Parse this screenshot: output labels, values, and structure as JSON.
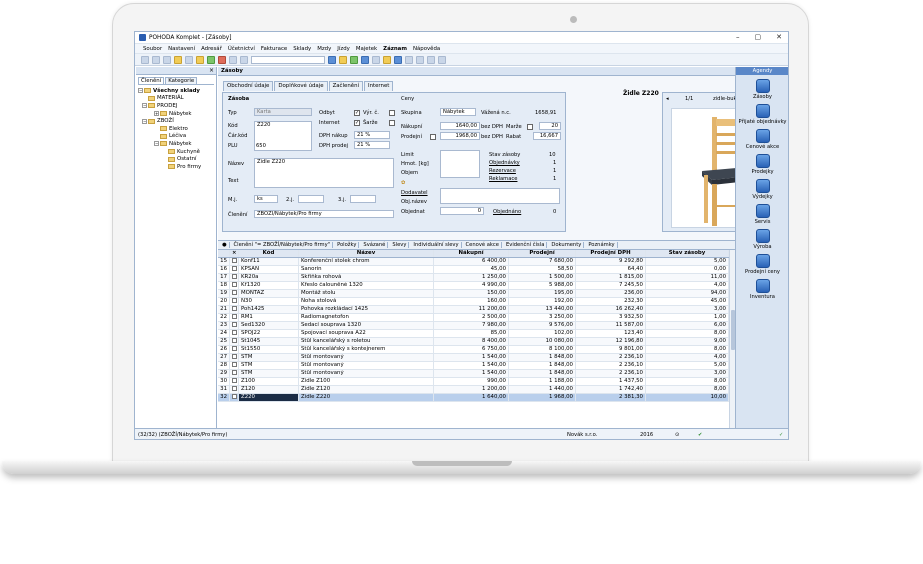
{
  "window": {
    "title": "POHODA Komplet - [Zásoby]",
    "controls": [
      "–",
      "▢",
      "✕"
    ]
  },
  "menu": [
    "Soubor",
    "Nastavení",
    "Adresář",
    "Účetnictví",
    "Fakturace",
    "Sklady",
    "Mzdy",
    "Jízdy",
    "Majetek",
    "Záznam",
    "Nápověda"
  ],
  "left_panel": {
    "tabs": [
      "Členění",
      "Kategorie"
    ],
    "tree": [
      {
        "label": "Všechny sklady",
        "level": 0,
        "expanded": true
      },
      {
        "label": "MATERIÁL",
        "level": 1
      },
      {
        "label": "PRODEJ",
        "level": 1,
        "expanded": true
      },
      {
        "label": "Nábytek",
        "level": 2
      },
      {
        "label": "ZBOŽÍ",
        "level": 1,
        "expanded": true
      },
      {
        "label": "Elektro",
        "level": 2
      },
      {
        "label": "Léčiva",
        "level": 2
      },
      {
        "label": "Nábytek",
        "level": 2,
        "expanded": true
      },
      {
        "label": "Kuchyně",
        "level": 3
      },
      {
        "label": "Ostatní",
        "level": 3
      },
      {
        "label": "Pro firmy",
        "level": 3
      }
    ]
  },
  "main": {
    "header": "Zásoby",
    "tabs": [
      "Obchodní údaje",
      "Doplňkové údaje",
      "Začlenění",
      "Internet"
    ],
    "product_title": "Židle Z220",
    "form": {
      "section": "Zásoba",
      "typ_label": "Typ",
      "typ_value": "Karta",
      "odbyt_label": "Odbyt",
      "vyr_label": "Výr. č.",
      "internet_label": "Internet",
      "sarze_label": "Šarže",
      "kod_label": "Kód",
      "kod_value": "Z220",
      "car_kod_label": "Čár.kód",
      "plu_label": "PLU",
      "plu_value": "650",
      "dph_nakup_label": "DPH nákup",
      "dph_nakup_value": "21 %",
      "dph_prodej_label": "DPH prodej",
      "dph_prodej_value": "21 %",
      "nazev_label": "Název",
      "nazev_value": "Židle Z220",
      "text_label": "Text",
      "mj_label": "M.j.",
      "mj_value": "ks",
      "zj_label": "2.j.",
      "tj_label": "3.j.",
      "cleneni_label": "Členění",
      "cleneni_value": "ZBOŽÍ/Nábytek/Pro firmy",
      "ceny_label": "Ceny",
      "skupina_label": "Skupina",
      "skupina_value": "Nábytek",
      "vazena_label": "Vážená n.c.",
      "vazena_value": "1658,91",
      "nakupni_label": "Nákupní",
      "nakupni_value": "1640,00",
      "bez_dph": "bez DPH",
      "marze_label": "Marže",
      "marze_value": "20",
      "prodejni_label": "Prodejní",
      "prodejni_value": "1968,00",
      "rabat_label": "Rabat",
      "rabat_value": "16,667",
      "limit_label": "Limit",
      "hmot_label": "Hmot. [kg]",
      "objem_label": "Objem",
      "stav_label": "Stav zásoby",
      "stav_value": "10",
      "objednavky_label": "Objednávky",
      "objednavky_value": "1",
      "rezervace_label": "Rezervace",
      "rezervace_value": "1",
      "reklamace_label": "Reklamace",
      "reklamace_value": "1",
      "dodavatel_label": "Dodavatel",
      "objnazev_label": "Obj.název",
      "objednat_label": "Objednat",
      "objednat_value": "0",
      "objednano_label": "Objednáno",
      "objednano_value": "0"
    },
    "image": {
      "counter": "1/1",
      "filename": "zidle-buk-velka.png"
    }
  },
  "agenda": {
    "title": "Agendy",
    "items": [
      "Zásoby",
      "Přijaté objednávky",
      "Cenové akce",
      "Prodejky",
      "Výdejky",
      "Servis",
      "Výroba",
      "Prodejní ceny",
      "Inventura"
    ]
  },
  "grid": {
    "tabs": [
      "Členění \"= ZBOŽÍ/Nábytek/Pro firmy\"",
      "Položky",
      "Svázané",
      "Slevy",
      "Individuální slevy",
      "Cenové akce",
      "Evidenční čísla",
      "Dokumenty",
      "Poznámky"
    ],
    "columns": [
      "",
      "",
      "Kód",
      "Název",
      "Nákupní",
      "Prodejní",
      "Prodejní DPH",
      "Stav zásoby"
    ],
    "rows": [
      [
        "15",
        "Konf11",
        "Konferenční stolek chrom",
        "6 400,00",
        "7 680,00",
        "9 292,80",
        "5,00"
      ],
      [
        "16",
        "KPSAN",
        "Sanorin",
        "45,00",
        "58,50",
        "64,40",
        "0,00"
      ],
      [
        "17",
        "KR20a",
        "Skříňka rohová",
        "1 250,00",
        "1 500,00",
        "1 815,00",
        "11,00"
      ],
      [
        "18",
        "Kř1320",
        "Křeslo čalouněné 1320",
        "4 990,00",
        "5 988,00",
        "7 245,50",
        "4,00"
      ],
      [
        "19",
        "MONTAZ",
        "Montáž stolu",
        "150,00",
        "195,00",
        "236,00",
        "94,00"
      ],
      [
        "20",
        "N30",
        "Noha stolová",
        "160,00",
        "192,00",
        "232,30",
        "45,00"
      ],
      [
        "21",
        "Poh1425",
        "Pohovka rozkládací 1425",
        "11 200,00",
        "13 440,00",
        "16 262,40",
        "3,00"
      ],
      [
        "22",
        "RM1",
        "Radiomagnetofon",
        "2 500,00",
        "3 250,00",
        "3 932,50",
        "1,00"
      ],
      [
        "23",
        "Sed1320",
        "Sedací souprava 1320",
        "7 980,00",
        "9 576,00",
        "11 587,00",
        "6,00"
      ],
      [
        "24",
        "SPOJ22",
        "Spojovací souprava A22",
        "85,00",
        "102,00",
        "123,40",
        "8,00"
      ],
      [
        "25",
        "St1045",
        "Stůl kancelářský s roletou",
        "8 400,00",
        "10 080,00",
        "12 196,80",
        "9,00"
      ],
      [
        "26",
        "St1550",
        "Stůl kancelářský s kontejnerem",
        "6 750,00",
        "8 100,00",
        "9 801,00",
        "8,00"
      ],
      [
        "27",
        "STM",
        "Stůl montovaný",
        "1 540,00",
        "1 848,00",
        "2 236,10",
        "4,00"
      ],
      [
        "28",
        "STM",
        "Stůl montovaný",
        "1 540,00",
        "1 848,00",
        "2 236,10",
        "5,00"
      ],
      [
        "29",
        "STM",
        "Stůl montovaný",
        "1 540,00",
        "1 848,00",
        "2 236,10",
        "3,00"
      ],
      [
        "30",
        "Z100",
        "Židle Z100",
        "990,00",
        "1 188,00",
        "1 437,50",
        "8,00"
      ],
      [
        "31",
        "Z120",
        "Židle Z120",
        "1 200,00",
        "1 440,00",
        "1 742,40",
        "8,00"
      ],
      [
        "32",
        "Z220",
        "Židle Z220",
        "1 640,00",
        "1 968,00",
        "2 381,30",
        "10,00"
      ]
    ]
  },
  "status": {
    "path": "(32/32) (ZBOŽÍ/Nábytek/Pro firmy)",
    "company": "Novák s.r.o.",
    "year": "2016"
  }
}
